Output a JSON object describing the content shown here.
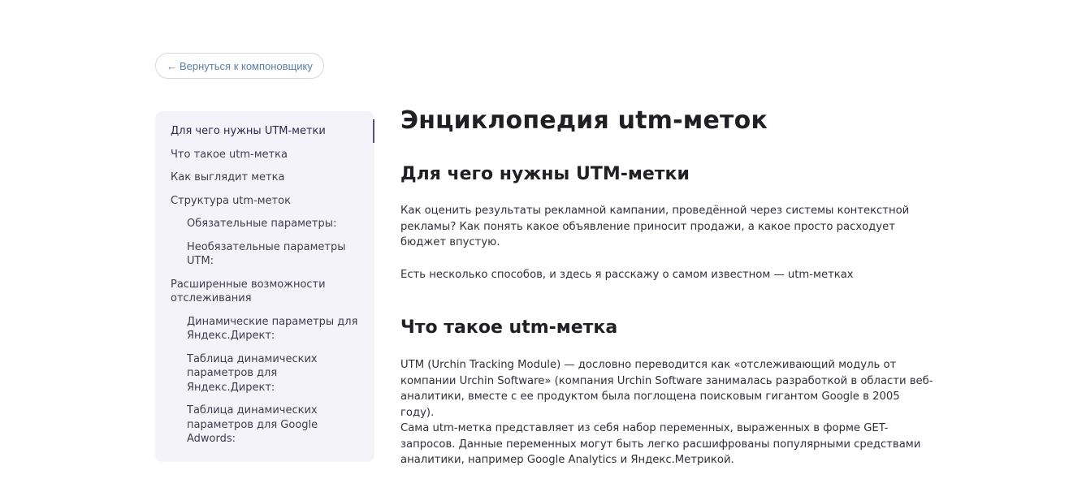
{
  "back_button": {
    "arrow": "←",
    "label": "Вернуться к компоновщику"
  },
  "toc": {
    "items": [
      {
        "label": "Для чего нужны UTM-метки",
        "level": 1,
        "active": true
      },
      {
        "label": "Что такое utm-метка",
        "level": 1,
        "active": false
      },
      {
        "label": "Как выглядит метка",
        "level": 1,
        "active": false
      },
      {
        "label": "Структура utm-меток",
        "level": 1,
        "active": false
      },
      {
        "label": "Обязательные параметры:",
        "level": 2,
        "active": false
      },
      {
        "label": "Необязательные параметры UTM:",
        "level": 2,
        "active": false
      },
      {
        "label": "Расширенные возможности отслеживания",
        "level": 1,
        "active": false
      },
      {
        "label": "Динамические параметры для Яндекс.Директ:",
        "level": 2,
        "active": false
      },
      {
        "label": "Таблица динамических параметров для Яндекс.Директ:",
        "level": 2,
        "active": false
      },
      {
        "label": "Таблица динамических параметров для Google Adwords:",
        "level": 2,
        "active": false
      }
    ]
  },
  "article": {
    "title": "Энциклопедия utm-меток",
    "sections": [
      {
        "heading": "Для чего нужны UTM-метки",
        "paragraphs": [
          "Как оценить результаты рекламной кампании, проведённой через системы контекстной рекламы? Как понять какое объявление приносит продажи, а какое просто расходует бюджет впустую.",
          "Есть несколько способов, и здесь я расскажу о самом известном — utm-метках"
        ]
      },
      {
        "heading": "Что такое utm-метка",
        "paragraphs": [
          "UTM (Urchin Tracking Module) — дословно переводится как «отслеживающий модуль от компании Urchin Software» (компания Urchin Software занималась разработкой в области веб-аналитики, вместе с ее продуктом была поглощена поисковым гигантом Google в 2005 году).",
          "Сама utm-метка представляет из себя набор переменных, выраженных в форме GET-запросов. Данные переменных могут быть легко расшифрованы популярными средствами аналитики, например Google Analytics и Яндекс.Метрикой."
        ]
      }
    ]
  },
  "colors": {
    "accent": "#5d4d8e",
    "link": "#5a7fa6",
    "toc_background": "#f5f3fa"
  }
}
